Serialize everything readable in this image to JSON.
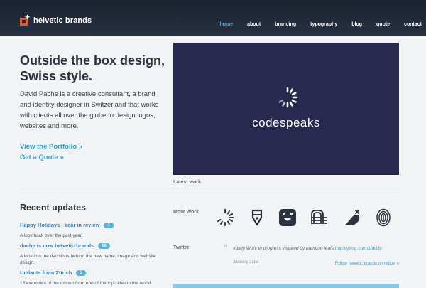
{
  "header": {
    "brand": "helvetic brands",
    "nav": [
      {
        "label": "home",
        "active": true
      },
      {
        "label": "about",
        "active": false
      },
      {
        "label": "branding",
        "active": false
      },
      {
        "label": "typography",
        "active": false
      },
      {
        "label": "blog",
        "active": false
      },
      {
        "label": "quote",
        "active": false
      },
      {
        "label": "contact",
        "active": false
      }
    ]
  },
  "intro": {
    "headline": "Outside the box design, Swiss style.",
    "body": "David Pache is a creative consultant, a brand and identity designer in Switzerland that works with clients all over the globe to design logos, websites and more.",
    "portfolio_link": "View the Portfolio »",
    "quote_link": "Get a Quote »"
  },
  "feature": {
    "logo_text": "codespeaks",
    "caption": "Latest work"
  },
  "recent": {
    "title": "Recent updates",
    "items": [
      {
        "title": "Happy Holidays | Year in review",
        "count": "1",
        "desc": "A look back over the past year."
      },
      {
        "title": "dache is now helvetic brands",
        "count": "16",
        "desc": "A look into the decisions behind the new name, image and website design."
      },
      {
        "title": "Umlauts from Zürich",
        "count": "5",
        "desc": "15 examples of the umlaut from one of the top cities in the world."
      }
    ]
  },
  "more_work": {
    "label": "More Work",
    "icons": [
      "spinner-logo-icon",
      "pen-nib-logo-icon",
      "smile-box-logo-icon",
      "stripes-logo-icon",
      "bird-logo-icon",
      "fingerprint-logo-icon"
    ]
  },
  "twitter": {
    "label": "Twitter",
    "quote_mark": "“",
    "tweet_text": "#daily Work in progress inspired by bamboo leafs ",
    "tweet_link": "http://yfrog.com/1dk1fp",
    "date": "January 22nd",
    "follow": "Follow helvetic brands on twitter »"
  },
  "colors": {
    "header_bg": "#1f2735",
    "accent": "#3b9fcf",
    "brand_orange": "#e8552a",
    "feature_bg": "#272a4e"
  }
}
